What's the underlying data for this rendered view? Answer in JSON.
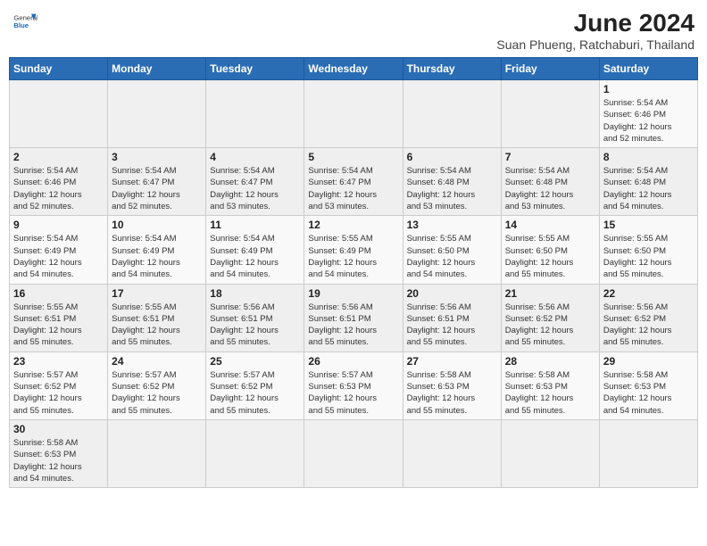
{
  "header": {
    "logo_general": "General",
    "logo_blue": "Blue",
    "month_year": "June 2024",
    "location": "Suan Phueng, Ratchaburi, Thailand"
  },
  "weekdays": [
    "Sunday",
    "Monday",
    "Tuesday",
    "Wednesday",
    "Thursday",
    "Friday",
    "Saturday"
  ],
  "weeks": [
    [
      {
        "day": "",
        "info": ""
      },
      {
        "day": "",
        "info": ""
      },
      {
        "day": "",
        "info": ""
      },
      {
        "day": "",
        "info": ""
      },
      {
        "day": "",
        "info": ""
      },
      {
        "day": "",
        "info": ""
      },
      {
        "day": "1",
        "info": "Sunrise: 5:54 AM\nSunset: 6:46 PM\nDaylight: 12 hours\nand 52 minutes."
      }
    ],
    [
      {
        "day": "2",
        "info": "Sunrise: 5:54 AM\nSunset: 6:46 PM\nDaylight: 12 hours\nand 52 minutes."
      },
      {
        "day": "3",
        "info": "Sunrise: 5:54 AM\nSunset: 6:47 PM\nDaylight: 12 hours\nand 52 minutes."
      },
      {
        "day": "4",
        "info": "Sunrise: 5:54 AM\nSunset: 6:47 PM\nDaylight: 12 hours\nand 53 minutes."
      },
      {
        "day": "5",
        "info": "Sunrise: 5:54 AM\nSunset: 6:47 PM\nDaylight: 12 hours\nand 53 minutes."
      },
      {
        "day": "6",
        "info": "Sunrise: 5:54 AM\nSunset: 6:48 PM\nDaylight: 12 hours\nand 53 minutes."
      },
      {
        "day": "7",
        "info": "Sunrise: 5:54 AM\nSunset: 6:48 PM\nDaylight: 12 hours\nand 53 minutes."
      },
      {
        "day": "8",
        "info": "Sunrise: 5:54 AM\nSunset: 6:48 PM\nDaylight: 12 hours\nand 54 minutes."
      }
    ],
    [
      {
        "day": "9",
        "info": "Sunrise: 5:54 AM\nSunset: 6:49 PM\nDaylight: 12 hours\nand 54 minutes."
      },
      {
        "day": "10",
        "info": "Sunrise: 5:54 AM\nSunset: 6:49 PM\nDaylight: 12 hours\nand 54 minutes."
      },
      {
        "day": "11",
        "info": "Sunrise: 5:54 AM\nSunset: 6:49 PM\nDaylight: 12 hours\nand 54 minutes."
      },
      {
        "day": "12",
        "info": "Sunrise: 5:55 AM\nSunset: 6:49 PM\nDaylight: 12 hours\nand 54 minutes."
      },
      {
        "day": "13",
        "info": "Sunrise: 5:55 AM\nSunset: 6:50 PM\nDaylight: 12 hours\nand 54 minutes."
      },
      {
        "day": "14",
        "info": "Sunrise: 5:55 AM\nSunset: 6:50 PM\nDaylight: 12 hours\nand 55 minutes."
      },
      {
        "day": "15",
        "info": "Sunrise: 5:55 AM\nSunset: 6:50 PM\nDaylight: 12 hours\nand 55 minutes."
      }
    ],
    [
      {
        "day": "16",
        "info": "Sunrise: 5:55 AM\nSunset: 6:51 PM\nDaylight: 12 hours\nand 55 minutes."
      },
      {
        "day": "17",
        "info": "Sunrise: 5:55 AM\nSunset: 6:51 PM\nDaylight: 12 hours\nand 55 minutes."
      },
      {
        "day": "18",
        "info": "Sunrise: 5:56 AM\nSunset: 6:51 PM\nDaylight: 12 hours\nand 55 minutes."
      },
      {
        "day": "19",
        "info": "Sunrise: 5:56 AM\nSunset: 6:51 PM\nDaylight: 12 hours\nand 55 minutes."
      },
      {
        "day": "20",
        "info": "Sunrise: 5:56 AM\nSunset: 6:51 PM\nDaylight: 12 hours\nand 55 minutes."
      },
      {
        "day": "21",
        "info": "Sunrise: 5:56 AM\nSunset: 6:52 PM\nDaylight: 12 hours\nand 55 minutes."
      },
      {
        "day": "22",
        "info": "Sunrise: 5:56 AM\nSunset: 6:52 PM\nDaylight: 12 hours\nand 55 minutes."
      }
    ],
    [
      {
        "day": "23",
        "info": "Sunrise: 5:57 AM\nSunset: 6:52 PM\nDaylight: 12 hours\nand 55 minutes."
      },
      {
        "day": "24",
        "info": "Sunrise: 5:57 AM\nSunset: 6:52 PM\nDaylight: 12 hours\nand 55 minutes."
      },
      {
        "day": "25",
        "info": "Sunrise: 5:57 AM\nSunset: 6:52 PM\nDaylight: 12 hours\nand 55 minutes."
      },
      {
        "day": "26",
        "info": "Sunrise: 5:57 AM\nSunset: 6:53 PM\nDaylight: 12 hours\nand 55 minutes."
      },
      {
        "day": "27",
        "info": "Sunrise: 5:58 AM\nSunset: 6:53 PM\nDaylight: 12 hours\nand 55 minutes."
      },
      {
        "day": "28",
        "info": "Sunrise: 5:58 AM\nSunset: 6:53 PM\nDaylight: 12 hours\nand 55 minutes."
      },
      {
        "day": "29",
        "info": "Sunrise: 5:58 AM\nSunset: 6:53 PM\nDaylight: 12 hours\nand 54 minutes."
      }
    ],
    [
      {
        "day": "30",
        "info": "Sunrise: 5:58 AM\nSunset: 6:53 PM\nDaylight: 12 hours\nand 54 minutes."
      },
      {
        "day": "",
        "info": ""
      },
      {
        "day": "",
        "info": ""
      },
      {
        "day": "",
        "info": ""
      },
      {
        "day": "",
        "info": ""
      },
      {
        "day": "",
        "info": ""
      },
      {
        "day": "",
        "info": ""
      }
    ]
  ]
}
